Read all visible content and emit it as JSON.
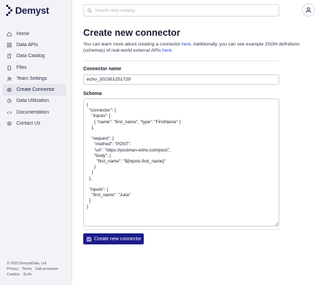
{
  "brand": {
    "name": "Demyst"
  },
  "search": {
    "placeholder": "Search data catalog"
  },
  "sidebar": {
    "items": [
      {
        "label": "Home",
        "icon": "home-icon"
      },
      {
        "label": "Data APIs",
        "icon": "api-icon"
      },
      {
        "label": "Data Catalog",
        "icon": "catalog-icon"
      },
      {
        "label": "Files",
        "icon": "file-icon"
      },
      {
        "label": "Team Settings",
        "icon": "team-icon"
      },
      {
        "label": "Create Connector",
        "icon": "connector-icon",
        "active": true
      },
      {
        "label": "Data Utilization",
        "icon": "utilization-icon"
      },
      {
        "label": "Documentation",
        "icon": "code-icon"
      },
      {
        "label": "Contact Us",
        "icon": "contact-icon"
      }
    ]
  },
  "footer": {
    "copyright": "© 2023 DemystData, Ltd",
    "links": [
      "Privacy",
      "Terms",
      "Sub-processor",
      "Cookies",
      "SLAs"
    ]
  },
  "page": {
    "title": "Create new connector",
    "intro_before": "You can learn more about creating a connector ",
    "intro_link1": "here",
    "intro_middle": ". Additionally, you can see example JSON definitions (schemas) of real-world external APIs ",
    "intro_link2": "here",
    "intro_after": ".",
    "name_label": "Connector name",
    "name_value": "echo_202301251729",
    "schema_label": "Schema",
    "schema_value": "{\n  \"connector\": {\n    \"inputs\": [\n      { \"name\": \"first_name\", \"type\": \"FirstName\" }\n    ],\n\n    \"request\": {\n      \"method\": \"POST\",\n      \"url\": \"https://postman-echo.com/post\",\n      \"body\": {\n        \"first_name\": \"${inputs.first_name}\"\n      }\n    }\n  },\n\n  \"inputs\": {\n    \"first_name\": \"Julia\"\n  }\n}",
    "submit_label": "Create new connector"
  },
  "colors": {
    "accent": "#1c1c8c",
    "link": "#2b3fd6",
    "sidebar_bg": "#f3f3f7"
  }
}
